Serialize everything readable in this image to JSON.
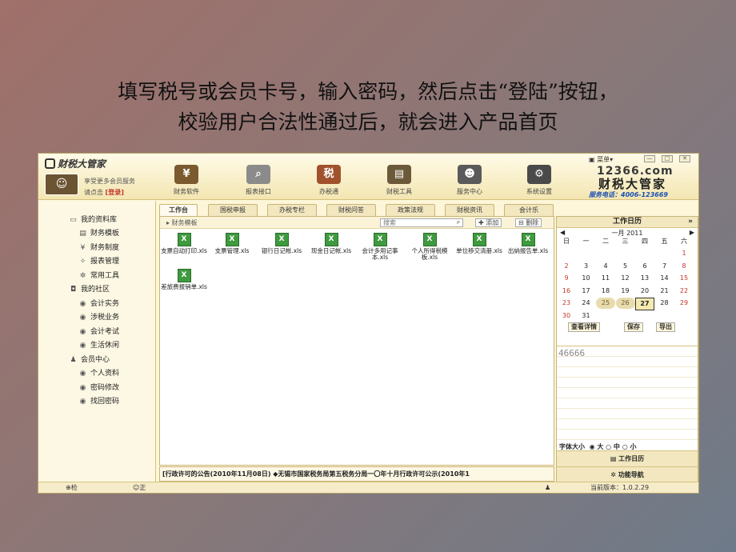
{
  "caption": {
    "line1": "填写税号或会员卡号，输入密码，然后点击“登陆”按钮，",
    "line2": "校验用户合法性通过后，就会进入产品首页"
  },
  "header": {
    "app_title": "财税大管家",
    "member_line1": "享受更多会员服务",
    "member_line2_prefix": "请点击",
    "login_label": "[登录]",
    "toolbar": [
      {
        "label": "财务软件",
        "icon": "yen-icon",
        "color": "#7a5a2e"
      },
      {
        "label": "报表接口",
        "icon": "magnifier-icon",
        "color": "#8b8b8b"
      },
      {
        "label": "办税通",
        "icon": "tax-icon",
        "color": "#a0522d"
      },
      {
        "label": "财税工具",
        "icon": "toolbox-icon",
        "color": "#6b5a3a"
      },
      {
        "label": "服务中心",
        "icon": "people-icon",
        "color": "#5a5a5a"
      },
      {
        "label": "系统设置",
        "icon": "gear-icon",
        "color": "#4a4a4a"
      }
    ],
    "menu_label": "菜单▾",
    "brand_number": "12366.com",
    "brand_name": "财税大管家",
    "hotline": "服务电话：4006-123669"
  },
  "sidebar": {
    "items": [
      {
        "label": "我的资料库",
        "icon": "monitor-icon"
      },
      {
        "label": "财务模板",
        "icon": "template-icon"
      },
      {
        "label": "财务制度",
        "icon": "yen-small-icon"
      },
      {
        "label": "报表管理",
        "icon": "report-icon"
      },
      {
        "label": "常用工具",
        "icon": "tool-icon"
      },
      {
        "label": "我的社区",
        "icon": "chat-icon"
      },
      {
        "label": "会计实务",
        "icon": "dot-icon"
      },
      {
        "label": "涉税业务",
        "icon": "dot-icon"
      },
      {
        "label": "会计考试",
        "icon": "dot-icon"
      },
      {
        "label": "生活休闲",
        "icon": "dot-icon"
      },
      {
        "label": "会员中心",
        "icon": "user-icon"
      },
      {
        "label": "个人资料",
        "icon": "dot-icon"
      },
      {
        "label": "密码修改",
        "icon": "dot-icon"
      },
      {
        "label": "找回密码",
        "icon": "dot-icon"
      }
    ]
  },
  "tabs": [
    "工作台",
    "国税申报",
    "办税专栏",
    "财税问答",
    "政策法规",
    "财税资讯",
    "会计乐"
  ],
  "main": {
    "breadcrumb": "▸ 财务模板",
    "search_placeholder": "搜索",
    "add_label": "添加",
    "delete_label": "删除",
    "files": [
      {
        "name": "支票自动打印.xls"
      },
      {
        "name": "支票管理.xls"
      },
      {
        "name": "银行日记帐.xls"
      },
      {
        "name": "现金日记帐.xls"
      },
      {
        "name": "会计多用记事本.xls"
      },
      {
        "name": "个人所得税模板.xls"
      },
      {
        "name": "单位移交清册.xls"
      },
      {
        "name": "出纳报告单.xls"
      },
      {
        "name": "差旅费报销单.xls"
      }
    ],
    "ticker": "[行政许可的公告(2010年11月08日) ◆无锡市国家税务局第五税务分局一〇年十月行政许可公示(2010年1"
  },
  "calendar": {
    "title": "工作日历",
    "more": "»",
    "month": "一月 2011",
    "weekdays": [
      "日",
      "一",
      "二",
      "三",
      "四",
      "五",
      "六"
    ],
    "weeks": [
      [
        "",
        "",
        "",
        "",
        "",
        "",
        "1"
      ],
      [
        "2",
        "3",
        "4",
        "5",
        "6",
        "7",
        "8"
      ],
      [
        "9",
        "10",
        "11",
        "12",
        "13",
        "14",
        "15"
      ],
      [
        "16",
        "17",
        "18",
        "19",
        "20",
        "21",
        "22"
      ],
      [
        "23",
        "24",
        "25",
        "26",
        "27",
        "28",
        "29"
      ],
      [
        "30",
        "31",
        "",
        "",
        "",
        "",
        ""
      ]
    ],
    "today": "27",
    "highlighted": [
      "25",
      "26"
    ],
    "view_detail": "查看详情",
    "save": "保存",
    "export": "导出",
    "note_text": "46666",
    "font_size_label": "字体大小",
    "font_options": [
      "大",
      "中",
      "小"
    ],
    "selected_font": "大",
    "btn_work_calendar": "工作日历",
    "btn_function_nav": "功能导航"
  },
  "status": {
    "check_update": "检查更新",
    "network_msg": "正在联网请求数据",
    "version": "当前版本：1.0.2.29"
  }
}
